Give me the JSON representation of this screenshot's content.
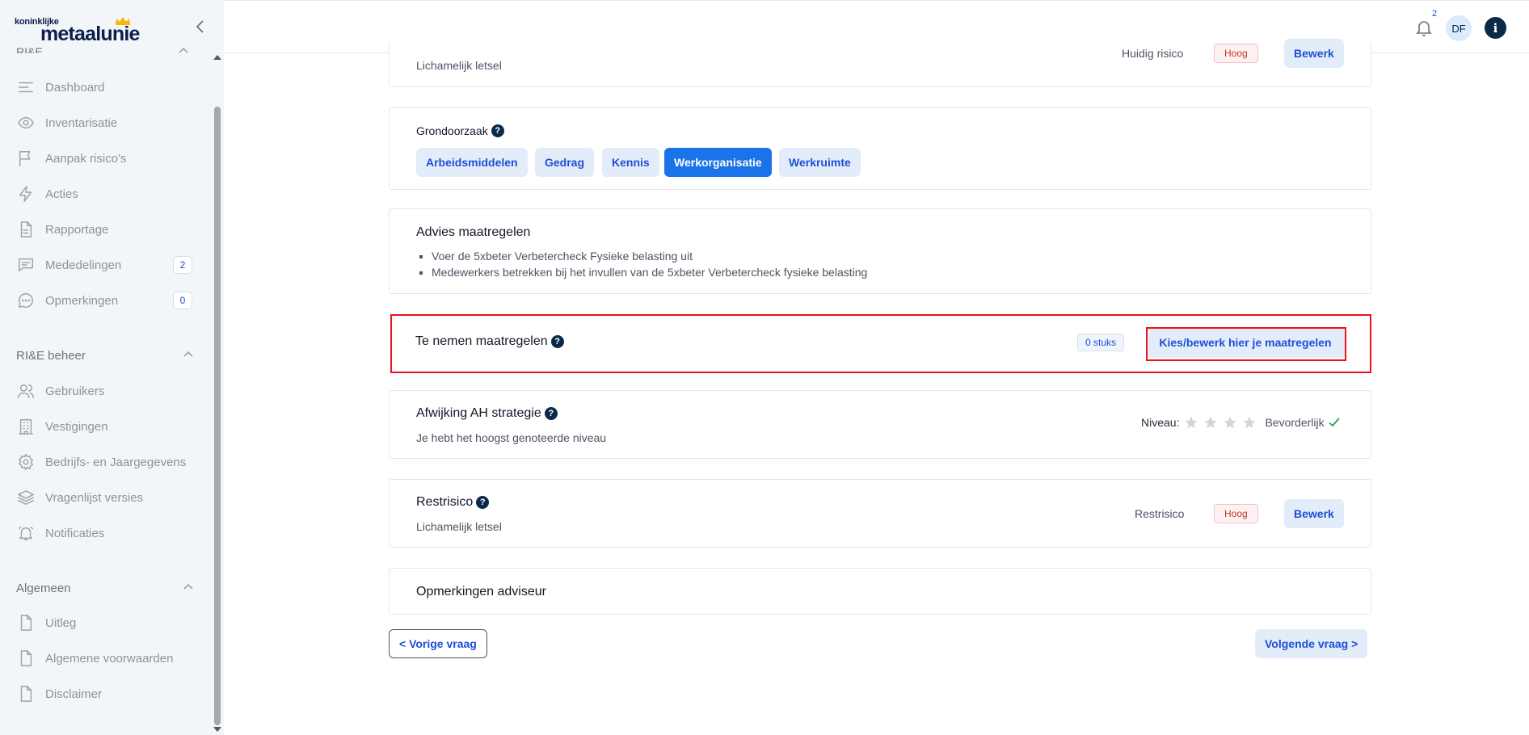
{
  "logo": {
    "small": "koninklijke",
    "big": "metaalunie"
  },
  "sidebar": {
    "cut_section": "RI&E",
    "items": [
      {
        "label": "Dashboard",
        "icon": "menu-lines-icon"
      },
      {
        "label": "Inventarisatie",
        "icon": "eye-icon"
      },
      {
        "label": "Aanpak risico's",
        "icon": "flag-icon"
      },
      {
        "label": "Acties",
        "icon": "lightning-icon"
      },
      {
        "label": "Rapportage",
        "icon": "document-icon"
      },
      {
        "label": "Mededelingen",
        "icon": "chat-icon",
        "badge": "2"
      },
      {
        "label": "Opmerkingen",
        "icon": "comment-dots-icon",
        "badge": "0"
      }
    ],
    "groups": [
      {
        "label": "RI&E beheer",
        "items": [
          {
            "label": "Gebruikers",
            "icon": "users-icon"
          },
          {
            "label": "Vestigingen",
            "icon": "building-icon"
          },
          {
            "label": "Bedrijfs- en Jaargegevens",
            "icon": "gear-icon"
          },
          {
            "label": "Vragenlijst versies",
            "icon": "layers-icon"
          },
          {
            "label": "Notificaties",
            "icon": "bell-icon"
          }
        ]
      },
      {
        "label": "Algemeen",
        "items": [
          {
            "label": "Uitleg",
            "icon": "file-icon"
          },
          {
            "label": "Algemene voorwaarden",
            "icon": "file-icon"
          },
          {
            "label": "Disclaimer",
            "icon": "file-icon"
          }
        ]
      }
    ]
  },
  "header": {
    "notification_count": "2",
    "avatar_initials": "DF",
    "info_label": "i"
  },
  "top_card": {
    "risk_label": "Huidig risico",
    "risk_value": "Hoog",
    "edit_label": "Bewerk",
    "subtitle": "Lichamelijk letsel"
  },
  "grondoorzaak": {
    "title": "Grondoorzaak",
    "chips": [
      {
        "label": "Arbeidsmiddelen",
        "active": false
      },
      {
        "label": "Gedrag",
        "active": false
      },
      {
        "label": "Kennis",
        "active": false
      },
      {
        "label": "Werkorganisatie",
        "active": true
      },
      {
        "label": "Werkruimte",
        "active": false
      }
    ]
  },
  "advies": {
    "title": "Advies maatregelen",
    "items": [
      "Voer de 5xbeter Verbetercheck Fysieke belasting uit",
      "Medewerkers betrekken bij het invullen van de 5xbeter Verbetercheck fysieke belasting"
    ]
  },
  "maatregelen": {
    "title": "Te nemen maatregelen",
    "count_label": "0 stuks",
    "button_label": "Kies/bewerk hier je maatregelen"
  },
  "afwijking": {
    "title": "Afwijking AH strategie",
    "subtitle": "Je hebt het hoogst genoteerde niveau",
    "niveau_label": "Niveau:",
    "stars_filled": 0,
    "stars_total": 4,
    "niveau_value": "Bevorderlijk"
  },
  "restrisico": {
    "title": "Restrisico",
    "subtitle": "Lichamelijk letsel",
    "risk_label": "Restrisico",
    "risk_value": "Hoog",
    "edit_label": "Bewerk"
  },
  "opmerkingen": {
    "title": "Opmerkingen adviseur"
  },
  "navigation": {
    "prev_label": "< Vorige vraag",
    "next_label": "Volgende vraag >"
  },
  "colors": {
    "primary": "#1a73e8",
    "navy": "#0b2a4a",
    "chip_bg": "#e3edf9",
    "highlight": "#e8131b",
    "risk_text": "#c0392b"
  }
}
